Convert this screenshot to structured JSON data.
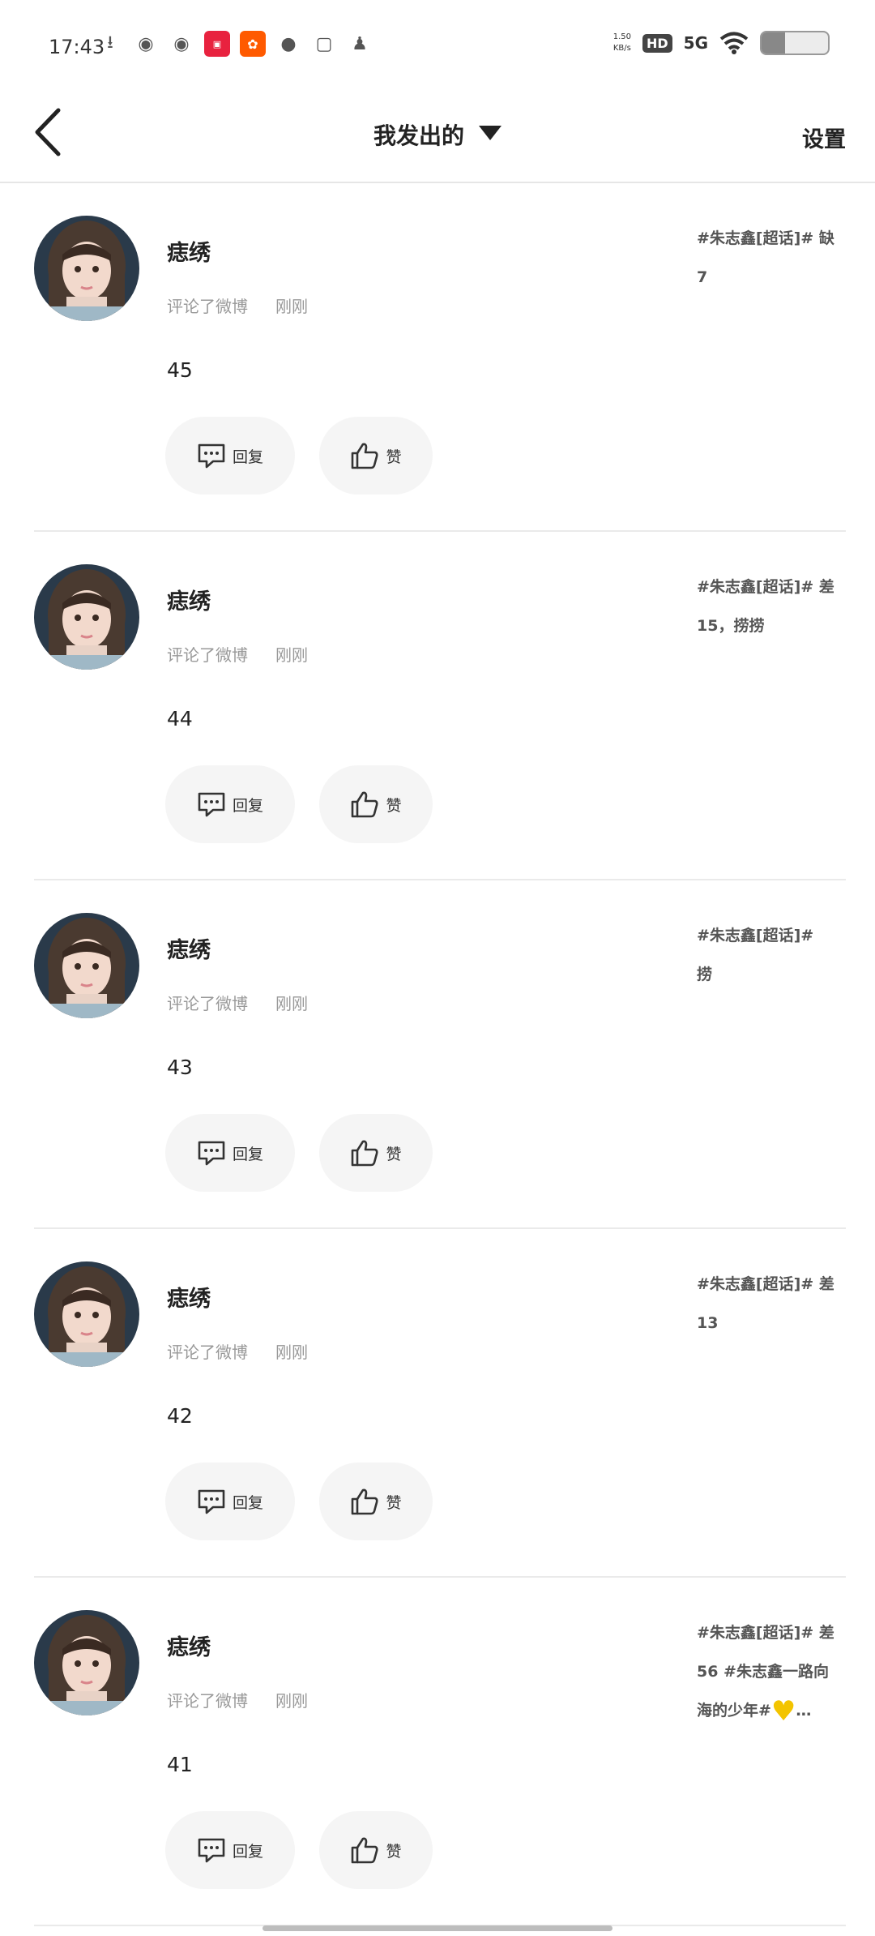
{
  "status_bar": {
    "time": "17:43",
    "network_speed_value": "1.50",
    "network_speed_unit": "KB/s",
    "hd_label": "HD",
    "signal_label": "5G",
    "battery_level": 0.35,
    "app_icons": [
      "download-icon",
      "weibo-icon",
      "weibo-icon",
      "xiaohongshu-icon",
      "kuaishou-icon",
      "chat-icon",
      "du-icon",
      "qq-icon"
    ]
  },
  "header": {
    "title": "我发出的",
    "settings_label": "设置"
  },
  "items": [
    {
      "username": "痣绣",
      "action": "评论了微博",
      "time": "刚刚",
      "content": "45",
      "ref_line1": "#朱志鑫[超话]# 缺",
      "ref_line2": "7",
      "ref_line3": "",
      "reply_label": "回复",
      "like_label": "赞"
    },
    {
      "username": "痣绣",
      "action": "评论了微博",
      "time": "刚刚",
      "content": "44",
      "ref_line1": "#朱志鑫[超话]# 差",
      "ref_line2": "15，捞捞",
      "ref_line3": "",
      "reply_label": "回复",
      "like_label": "赞"
    },
    {
      "username": "痣绣",
      "action": "评论了微博",
      "time": "刚刚",
      "content": "43",
      "ref_line1": "#朱志鑫[超话]#",
      "ref_line2": "捞",
      "ref_line3": "",
      "reply_label": "回复",
      "like_label": "赞"
    },
    {
      "username": "痣绣",
      "action": "评论了微博",
      "time": "刚刚",
      "content": "42",
      "ref_line1": "#朱志鑫[超话]# 差",
      "ref_line2": "13",
      "ref_line3": "",
      "reply_label": "回复",
      "like_label": "赞"
    },
    {
      "username": "痣绣",
      "action": "评论了微博",
      "time": "刚刚",
      "content": "41",
      "ref_line1": "#朱志鑫[超话]# 差",
      "ref_line2": "56 #朱志鑫一路向",
      "ref_line3": "海的少年#",
      "ref_ellipsis": "…",
      "reply_label": "回复",
      "like_label": "赞"
    }
  ]
}
